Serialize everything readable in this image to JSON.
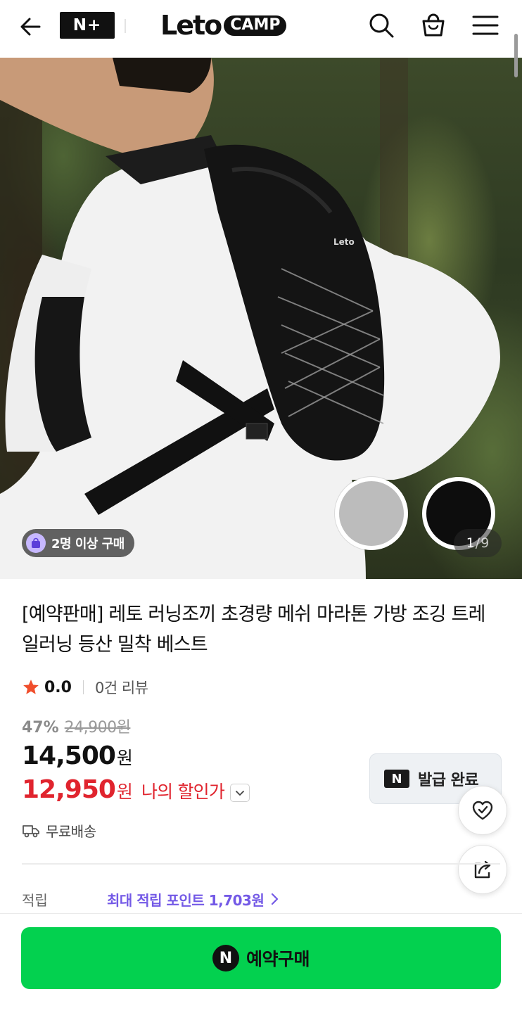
{
  "header": {
    "back_icon": "arrow-left-icon",
    "nplus_label": "N+",
    "logo_leto": "Leto",
    "logo_camp": "CAMP",
    "search_icon": "search-icon",
    "cart_icon": "shopping-bag-icon",
    "menu_icon": "hamburger-menu-icon"
  },
  "hero": {
    "group_buy_badge": "2명 이상 구매",
    "color_options": [
      {
        "name": "gray",
        "color": "#bcbcbc"
      },
      {
        "name": "black",
        "color": "#0d0d0d"
      }
    ],
    "page_current": "1",
    "page_separator": "/",
    "page_total": "9"
  },
  "product": {
    "title": "[예약판매] 레토 러닝조끼 초경량 메쉬 마라톤 가방 조깅 트레일러닝 등산 밀착 베스트",
    "rating": "0.0",
    "review_count": "0건 리뷰",
    "discount_rate": "47%",
    "original_price": "24,900원",
    "price_number": "14,500",
    "price_unit": "원",
    "my_price_number": "12,950",
    "my_price_unit": "원",
    "my_price_label": "나의 할인가",
    "coupon_badge": "N",
    "coupon_label": "발급 완료",
    "delivery": "무료배송",
    "points_label": "적립",
    "points_value": "최대 적립 포인트 1,703원"
  },
  "bottom": {
    "buy_badge": "N",
    "buy_label": "예약구매"
  },
  "colors": {
    "accent_red": "#e0242e",
    "naver_green": "#03d14f",
    "points_purple": "#7359e6",
    "star": "#f04e2c"
  }
}
